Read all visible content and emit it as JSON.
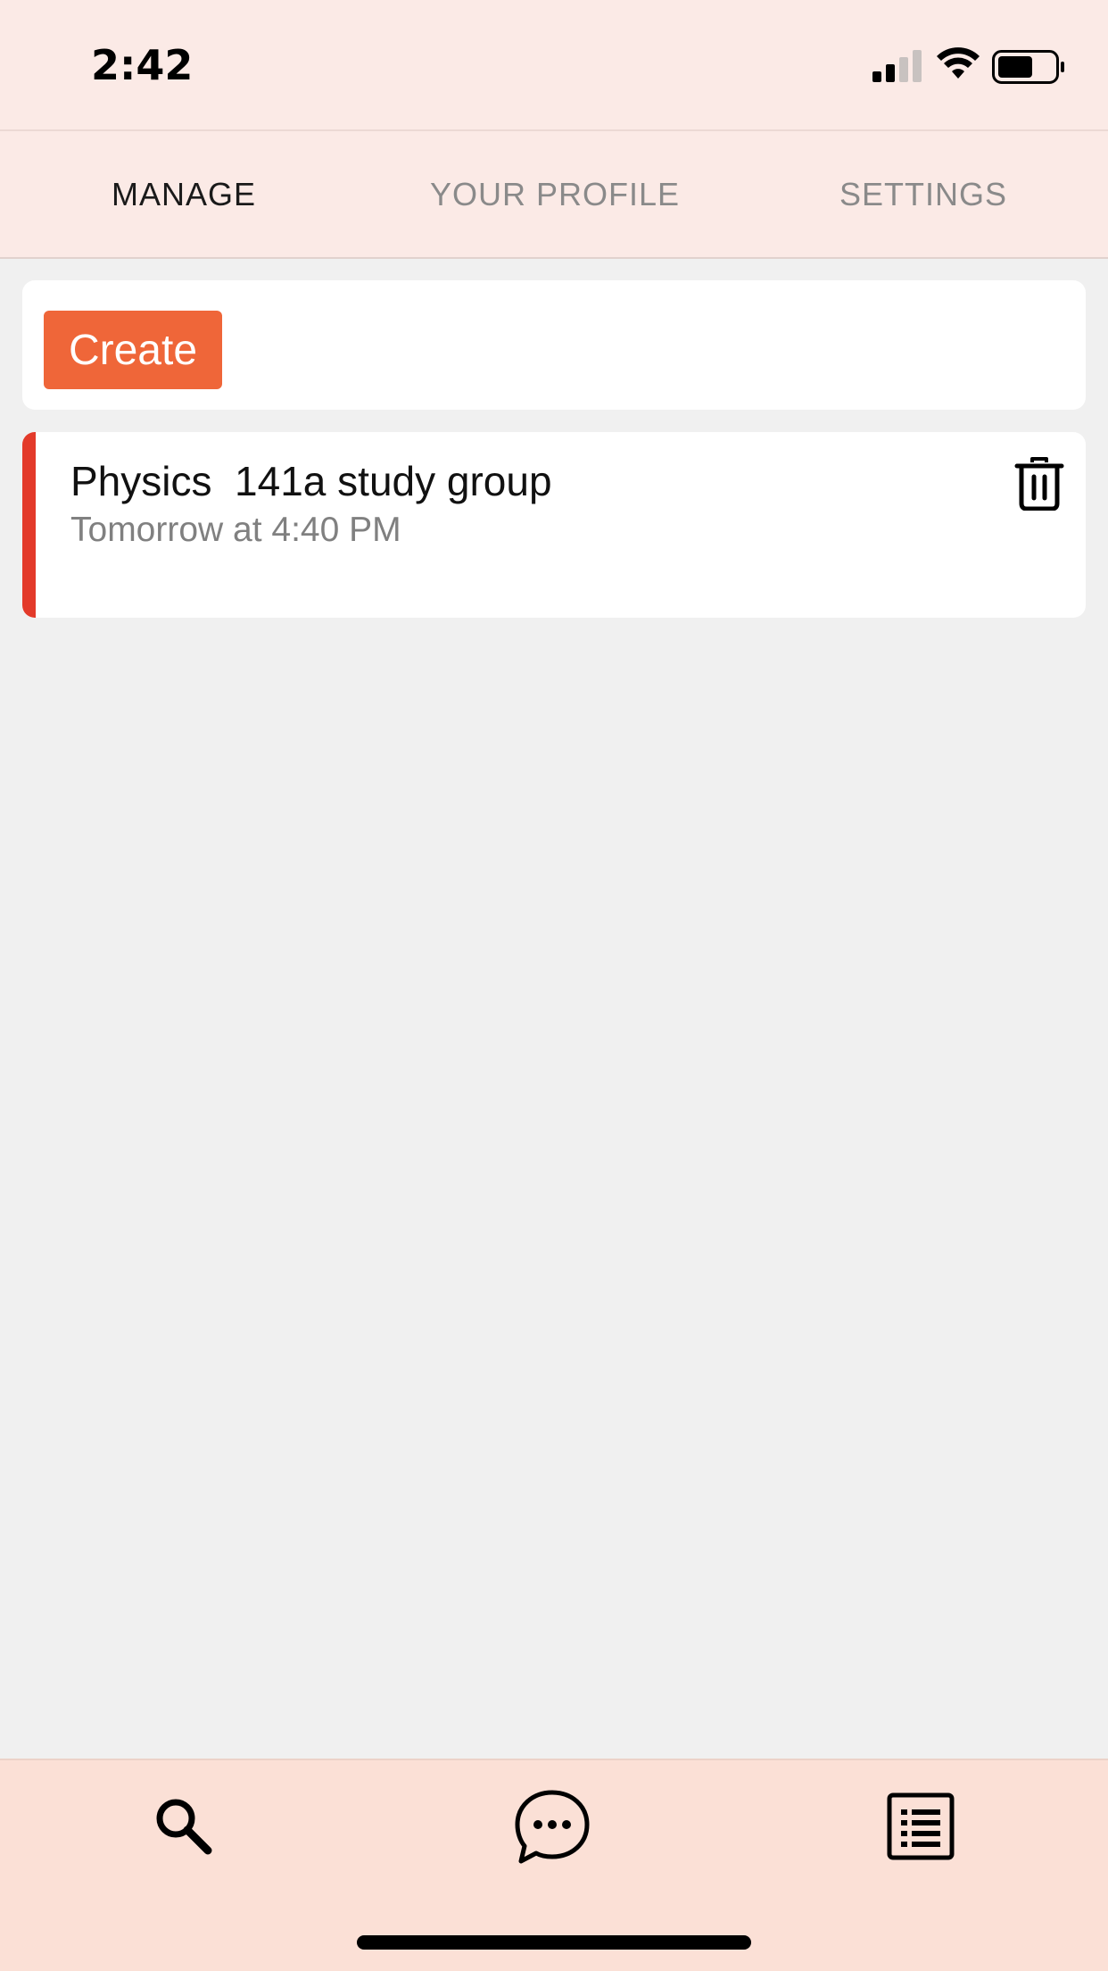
{
  "status_bar": {
    "time": "2:42",
    "icons": [
      "cellular-signal-icon",
      "wifi-icon",
      "battery-icon"
    ],
    "signal_bars_active": 2,
    "signal_bars_total": 4,
    "battery_level": 0.6
  },
  "top_tabs": {
    "items": [
      {
        "label": "MANAGE",
        "active": true
      },
      {
        "label": "YOUR PROFILE",
        "active": false
      },
      {
        "label": "SETTINGS",
        "active": false
      }
    ]
  },
  "create": {
    "button_label": "Create"
  },
  "events": [
    {
      "title": "Physics  141a study group",
      "time": "Tomorrow at 4:40 PM",
      "icon": "trash-icon"
    }
  ],
  "bottom_nav": {
    "items": [
      {
        "icon": "search-icon"
      },
      {
        "icon": "chat-bubble-icon"
      },
      {
        "icon": "list-icon"
      }
    ]
  },
  "colors": {
    "header_bg": "#fbeae6",
    "bottom_nav_bg": "#fbe0d6",
    "accent": "#ef6639",
    "event_accent": "#e33a2a",
    "page_bg": "#f0f0f0"
  }
}
